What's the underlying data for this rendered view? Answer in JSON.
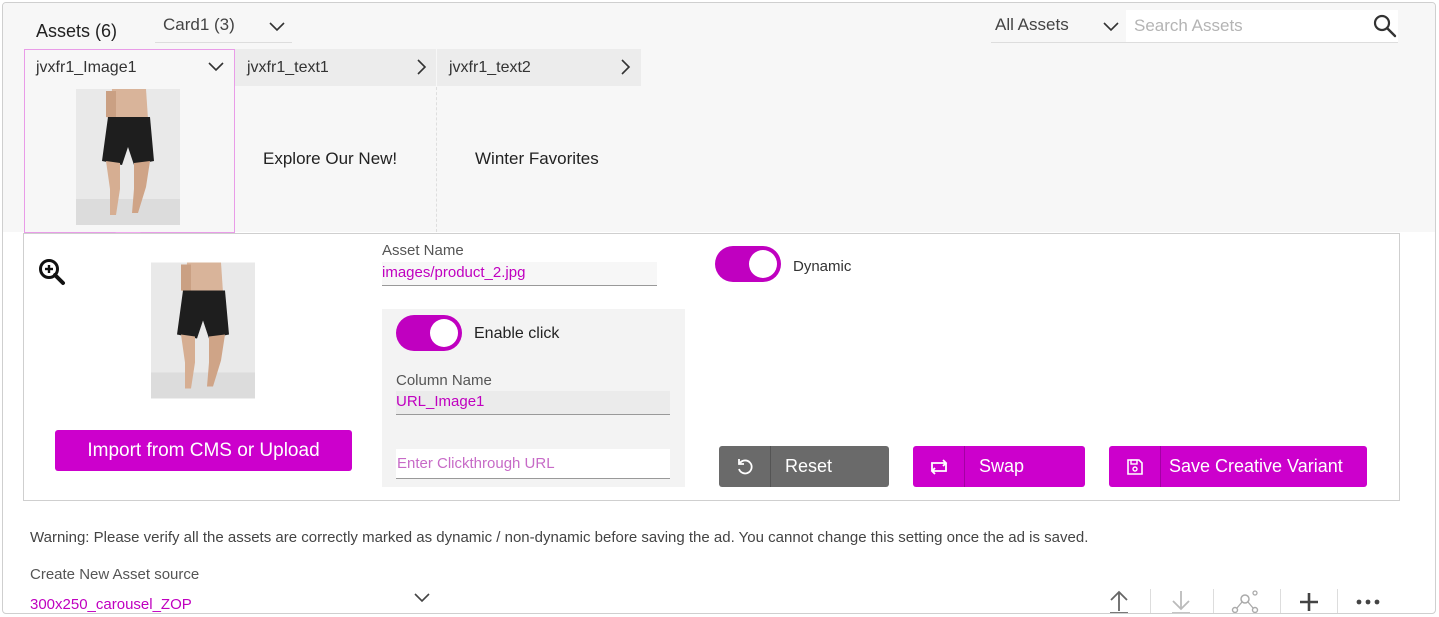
{
  "header": {
    "assets_title": "Assets (6)",
    "card_select": "Card1 (3)",
    "filter_select": "All Assets",
    "search_placeholder": "Search Assets"
  },
  "asset_tabs": [
    {
      "label": "jvxfr1_Image1",
      "selected": true
    },
    {
      "label": "jvxfr1_text1"
    },
    {
      "label": "jvxfr1_text2"
    }
  ],
  "asset_previews": {
    "text1": "Explore Our New!",
    "text2": "Winter Favorites"
  },
  "detail": {
    "asset_name_label": "Asset Name",
    "asset_name_value": "images/product_2.jpg",
    "dynamic_label": "Dynamic",
    "dynamic_on": true,
    "enable_click_label": "Enable click",
    "enable_click_on": true,
    "column_name_label": "Column Name",
    "column_name_value": "URL_Image1",
    "clickthrough_placeholder": "Enter Clickthrough URL",
    "import_button": "Import from CMS or Upload",
    "reset_button": "Reset",
    "swap_button": "Swap",
    "save_button": "Save Creative Variant"
  },
  "footer": {
    "warning": "Warning: Please verify all the assets are correctly marked as dynamic / non-dynamic before saving the ad. You cannot change this setting once the ad is saved.",
    "create_source_label": "Create New Asset source",
    "create_source_value": "300x250_carousel_ZOP"
  },
  "icons": {
    "search": "search-icon",
    "zoom": "zoom-in-icon",
    "reset": "undo-icon",
    "swap": "swap-icon",
    "save": "floppy-disk-icon",
    "upload": "upload-icon",
    "download": "download-icon",
    "network": "network-icon",
    "add": "plus-icon",
    "more": "more-horizontal-icon"
  },
  "colors": {
    "accent": "#cc00cc",
    "neutral_button": "#6a6a6a"
  }
}
